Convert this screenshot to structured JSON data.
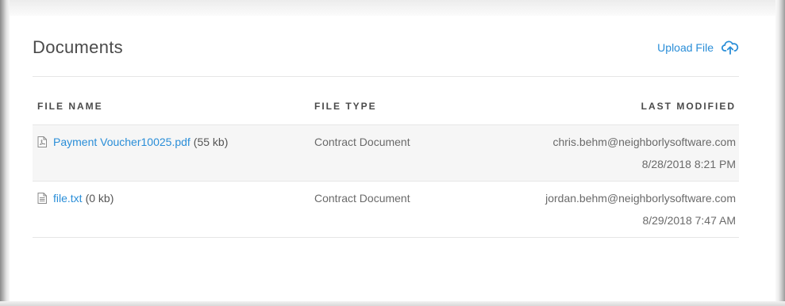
{
  "panel": {
    "title": "Documents",
    "upload_label": "Upload File"
  },
  "table": {
    "headers": {
      "name": "FILE NAME",
      "type": "FILE TYPE",
      "modified": "LAST MODIFIED"
    },
    "rows": [
      {
        "icon": "pdf-file-icon",
        "file_name": "Payment Voucher10025.pdf",
        "size": "(55 kb)",
        "file_type": "Contract Document",
        "modified_by": "chris.behm@neighborlysoftware.com",
        "modified_at": "8/28/2018 8:21 PM"
      },
      {
        "icon": "text-file-icon",
        "file_name": "file.txt",
        "size": "(0 kb)",
        "file_type": "Contract Document",
        "modified_by": "jordan.behm@neighborlysoftware.com",
        "modified_at": "8/29/2018 7:47 AM"
      }
    ]
  },
  "colors": {
    "link": "#2a8ed8",
    "text": "#6a6a6a",
    "row_alt": "#f6f6f6"
  }
}
